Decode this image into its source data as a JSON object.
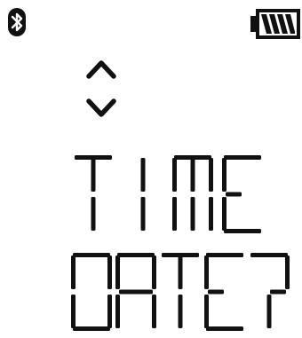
{
  "status_bar": {
    "bluetooth_icon": "bluetooth-icon",
    "battery_icon": "battery-full-icon",
    "battery_level": 1.0
  },
  "navigation": {
    "up_icon": "chevron-up-icon",
    "down_icon": "chevron-down-icon"
  },
  "display": {
    "line1": "TIME",
    "line2": "DATE?"
  },
  "colors": {
    "ink": "#111111",
    "background": "#ffffff"
  }
}
